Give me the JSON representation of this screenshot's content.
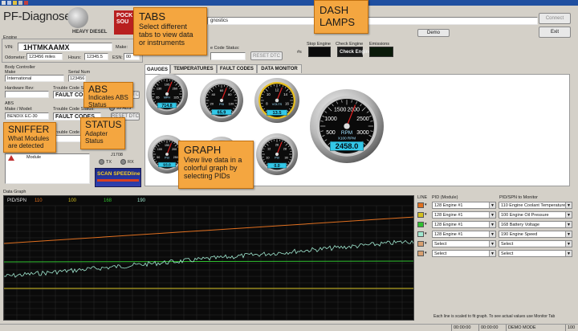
{
  "app": {
    "title": "PF-Diagnose",
    "brand_left": "PF",
    "vehicle_badge": "HEAVY DIESEL",
    "logo_text": "POCK SOU"
  },
  "colors": {
    "accent": "#f4a640",
    "graph_bg": "#0a0a0a",
    "titlebar": "#1f4fa0"
  },
  "header": {
    "search_value": "gnostics",
    "demo_label": "Demo",
    "connect_label": "Connect",
    "exit_label": "Exit",
    "engine_group": "Engine",
    "vin_label": "VIN:",
    "vin_value": "1HTMKAAMX",
    "make_label": "Make:",
    "odometer_label": "Odometer:",
    "odometer_value": "123456 miles",
    "hours_label": "Hours:",
    "hours_value": "12345.5",
    "esn_label": "ESN:",
    "esn_value": "00",
    "trouble_code_label": "e Code Status:",
    "reset_label": "RESET DTC",
    "stop_engine_label": "Stop Engine",
    "check_engine_label": "Check Engine",
    "check_engine_lamp": "Check Engine",
    "emissions_label": "Emissions",
    "num_label": "#s"
  },
  "left": {
    "body_controller": "Body Controller",
    "make_label": "Make",
    "make_value": "International",
    "serial_label": "Serial Num",
    "serial_value": "123456",
    "hardware_label": "Hardware Rev:",
    "tc_label": "Trouble Code Status:",
    "fault_codes": "FAULT CODES",
    "reset_dtc": "RESET DTC",
    "abs_group": "ABS",
    "abs_make_label": "Make / Model:",
    "abs_make_value": "BENDIX EC-30",
    "abs_tc_label": "Trouble Code Status:",
    "abs_fault": "FAULT CODES",
    "abs_reset": "RESET DTC",
    "abs_indicator": "99 ABS",
    "tc2_label": "Trouble Code",
    "de_label": "D",
    "module_label": "Module",
    "adapter_code": "J1708",
    "tx_label": "TX",
    "rx_label": "RX",
    "scan_logo": "SCAN SPEEDline"
  },
  "tabs": [
    {
      "label": "GAUGES"
    },
    {
      "label": "TEMPERATURES"
    },
    {
      "label": "FAULT CODES"
    },
    {
      "label": "DATA MONITOR"
    }
  ],
  "gauges": [
    {
      "unit": "MPH",
      "value": "714.8",
      "ticks": [
        "65",
        "130",
        "195",
        "260",
        "325"
      ]
    },
    {
      "unit": "PSI",
      "value": "65.9",
      "ticks": [
        "20",
        "40",
        "60",
        "80",
        "100"
      ]
    },
    {
      "unit": "VOLTS",
      "value": "13.5",
      "ticks": [
        "8",
        "10",
        "12",
        "14",
        "16"
      ]
    },
    {
      "unit": "PSI",
      "value": "93.0",
      "ticks": [
        "50",
        "100",
        "150",
        "200",
        "250"
      ]
    },
    {
      "unit": "PSI",
      "value": "",
      "ticks": []
    },
    {
      "unit": "PSI",
      "value": "0.0",
      "ticks": [
        "10",
        "12",
        "26",
        "28",
        "30"
      ]
    },
    {
      "unit": "RPM",
      "value": "2458.0",
      "ticks": [
        "500",
        "1000",
        "1500",
        "2000",
        "2500",
        "3000"
      ],
      "label": "X100 RPM"
    }
  ],
  "graph": {
    "group_label": "Data Graph",
    "pid_label": "PID/SPN",
    "pid_ids": [
      "110",
      "100",
      "168",
      "190"
    ],
    "line_header": "LINE",
    "pid_header": "PID (Module)",
    "spn_header": "PID/SPN to Monitor",
    "rows": [
      {
        "color": "#e07020",
        "module": "128 Engine #1",
        "pid": "110 Engine Coolant Temperature"
      },
      {
        "color": "#d4c020",
        "module": "128 Engine #1",
        "pid": "100 Engine Oil Pressure"
      },
      {
        "color": "#30c030",
        "module": "128 Engine #1",
        "pid": "168 Battery Voltage"
      },
      {
        "color": "#a0e8d0",
        "module": "128 Engine #1",
        "pid": "190 Engine Speed"
      },
      {
        "color": "#d8a070",
        "module": "Select",
        "pid": "Select"
      },
      {
        "color": "#d8a070",
        "module": "Select",
        "pid": "Select"
      }
    ],
    "footnote": "Each line is scaled to fit graph.  To see actual values use Monitor Tab"
  },
  "status_bar": {
    "cell1": "00:00:00",
    "cell2": "00:00:00",
    "cell3": "DEMO MODE",
    "cell4": "100"
  },
  "callouts": [
    {
      "title": "TABS",
      "desc": "Select different tabs to view data or instruments"
    },
    {
      "title": "DASH LAMPS",
      "desc": ""
    },
    {
      "title": "ABS",
      "desc": "Indicates ABS Status"
    },
    {
      "title": "SNIFFER",
      "desc": "What Modules are detected"
    },
    {
      "title": "STATUS",
      "desc": "Adapter Status"
    },
    {
      "title": "GRAPH",
      "desc": "View live data in a colorful graph by selecting PIDs"
    }
  ]
}
